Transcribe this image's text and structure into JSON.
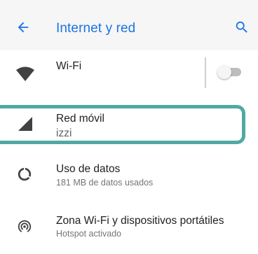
{
  "header": {
    "title": "Internet y red",
    "back_icon": "arrow-back-icon",
    "search_icon": "search-icon"
  },
  "items": [
    {
      "title": "Wi-Fi",
      "subtitle": "",
      "icon": "wifi-icon"
    },
    {
      "title": "Red móvil",
      "subtitle": "izzi",
      "icon": "cellular-signal-icon"
    },
    {
      "title": "Uso de datos",
      "subtitle": "181 MB de datos usados",
      "icon": "data-usage-icon"
    },
    {
      "title": "Zona Wi-Fi y dispositivos portátiles",
      "subtitle": "Hotspot activado",
      "icon": "hotspot-icon"
    }
  ],
  "wifi_toggle": {
    "on": false
  },
  "colors": {
    "accent": "#1a73e8",
    "highlight": "#4fa9a2",
    "appbar_bg": "#f6f6f6",
    "icon": "#424242"
  }
}
